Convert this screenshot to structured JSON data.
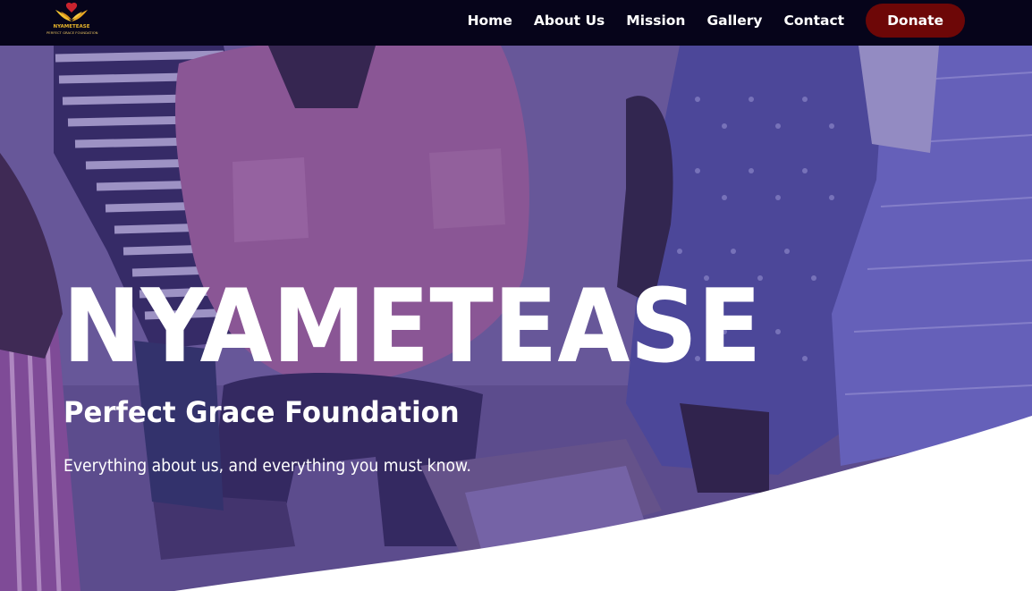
{
  "logo": {
    "title": "NYAMETEASE",
    "subtitle": "PERFECT GRACE FOUNDATION"
  },
  "nav": {
    "links": [
      "Home",
      "About Us",
      "Mission",
      "Gallery",
      "Contact"
    ],
    "donate_label": "Donate"
  },
  "hero": {
    "title": "NYAMETEASE",
    "subtitle": "Perfect Grace Foundation",
    "tagline": "Everything about us, and everything you must know."
  },
  "colors": {
    "navbar_bg": "#06041a",
    "donate_bg": "#6d0707",
    "hero_overlay": "#5e4d93",
    "logo_gold": "#e7b52b",
    "logo_red": "#c9232e"
  }
}
